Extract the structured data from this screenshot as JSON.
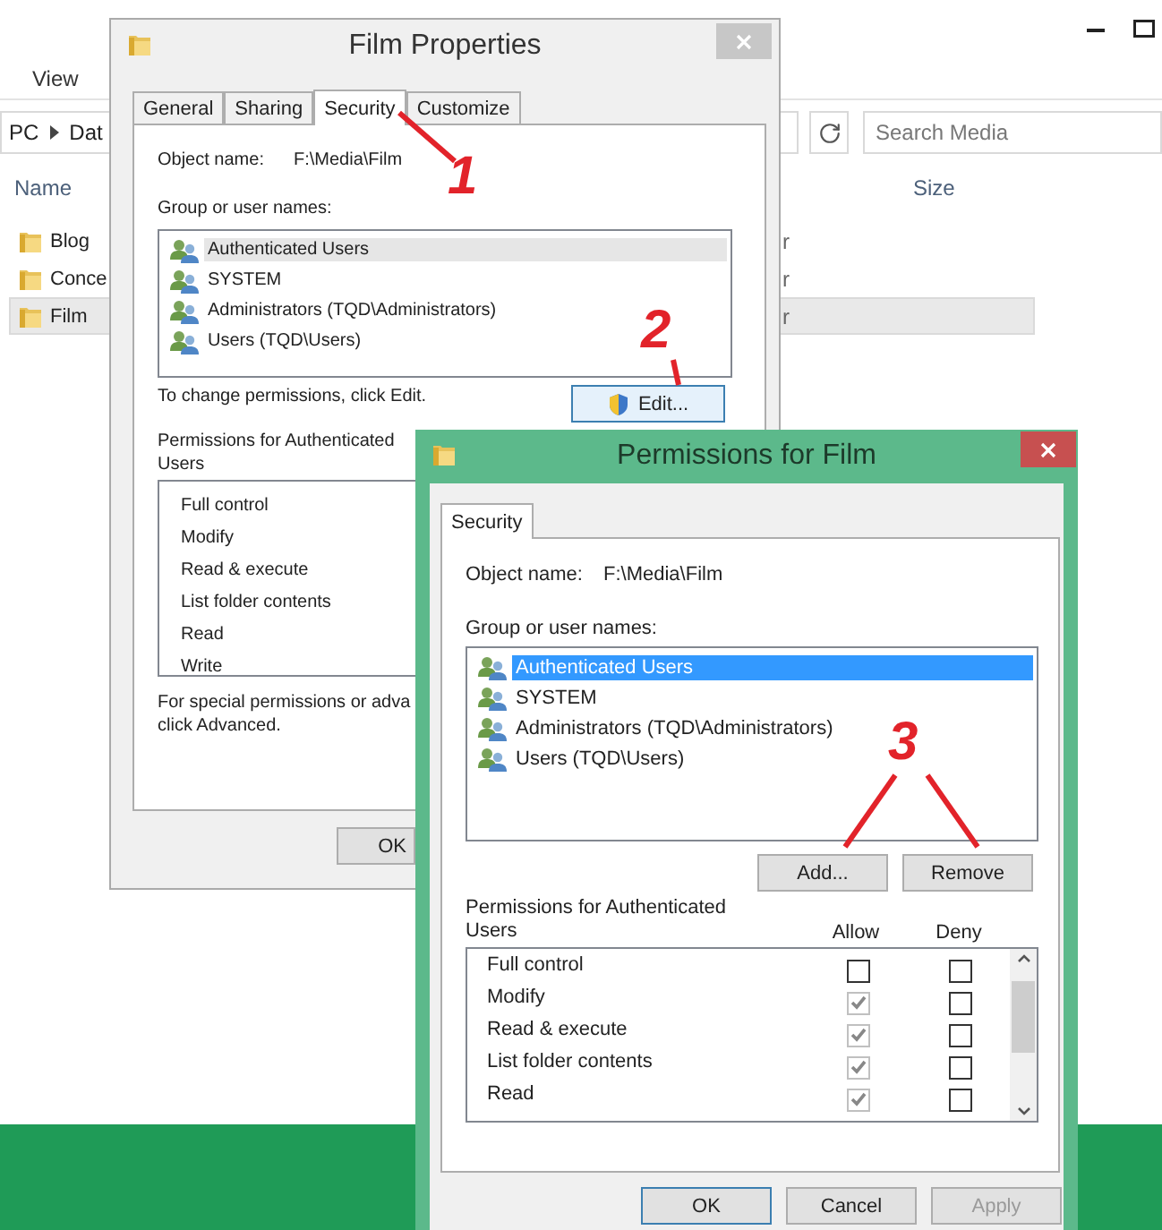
{
  "explorer": {
    "ribbon_tab": "View",
    "breadcrumb": [
      "PC",
      "Dat"
    ],
    "search": {
      "placeholder": "Search Media"
    },
    "columns": [
      "Name",
      "Size"
    ],
    "rows": [
      {
        "name": "Blog",
        "column_2": "r",
        "selected": false
      },
      {
        "name": "Conce",
        "column_2": "r",
        "selected": false
      },
      {
        "name": "Film",
        "column_2": "r",
        "selected": true
      }
    ]
  },
  "film_properties": {
    "title": "Film Properties",
    "tabs": [
      {
        "label": "General",
        "selected": false
      },
      {
        "label": "Sharing",
        "selected": false
      },
      {
        "label": "Security",
        "selected": true
      },
      {
        "label": "Customize",
        "selected": false
      }
    ],
    "object_name_label": "Object name:",
    "object_name": "F:\\Media\\Film",
    "group_label": "Group or user names:",
    "users": [
      {
        "name": "Authenticated Users",
        "selected": true
      },
      {
        "name": "SYSTEM",
        "selected": false
      },
      {
        "name": "Administrators (TQD\\Administrators)",
        "selected": false
      },
      {
        "name": "Users (TQD\\Users)",
        "selected": false
      }
    ],
    "edit_hint": "To change permissions, click Edit.",
    "edit_button": {
      "label": "Edit...",
      "highlighted": true
    },
    "permissions_label": "Permissions for Authenticated Users",
    "permissions": [
      "Full control",
      "Modify",
      "Read & execute",
      "List folder contents",
      "Read",
      "Write"
    ],
    "special_hint": [
      "For special permissions or adva",
      "click Advanced."
    ],
    "buttons": [
      {
        "label": "OK"
      }
    ]
  },
  "permissions_dialog": {
    "title": "Permissions for Film",
    "tabs": [
      {
        "label": "Security",
        "selected": true
      }
    ],
    "object_name_label": "Object name:",
    "object_name": "F:\\Media\\Film",
    "group_label": "Group or user names:",
    "users": [
      {
        "name": "Authenticated Users",
        "selected": true
      },
      {
        "name": "SYSTEM",
        "selected": false
      },
      {
        "name": "Administrators (TQD\\Administrators)",
        "selected": false
      },
      {
        "name": "Users (TQD\\Users)",
        "selected": false
      }
    ],
    "list_buttons": [
      "Add...",
      "Remove"
    ],
    "permissions_label": "Permissions for Authenticated Users",
    "allow_header": "Allow",
    "deny_header": "Deny",
    "permissions": [
      {
        "name": "Full control",
        "allow": false,
        "deny": false
      },
      {
        "name": "Modify",
        "allow": true,
        "deny": false
      },
      {
        "name": "Read & execute",
        "allow": true,
        "deny": false
      },
      {
        "name": "List folder contents",
        "allow": true,
        "deny": false
      },
      {
        "name": "Read",
        "allow": true,
        "deny": false
      }
    ],
    "buttons": [
      {
        "label": "OK",
        "default": true,
        "disabled": false
      },
      {
        "label": "Cancel",
        "default": false,
        "disabled": false
      },
      {
        "label": "Apply",
        "default": false,
        "disabled": true
      }
    ]
  },
  "annotations": [
    {
      "label": "1"
    },
    {
      "label": "2"
    },
    {
      "label": "3"
    }
  ]
}
